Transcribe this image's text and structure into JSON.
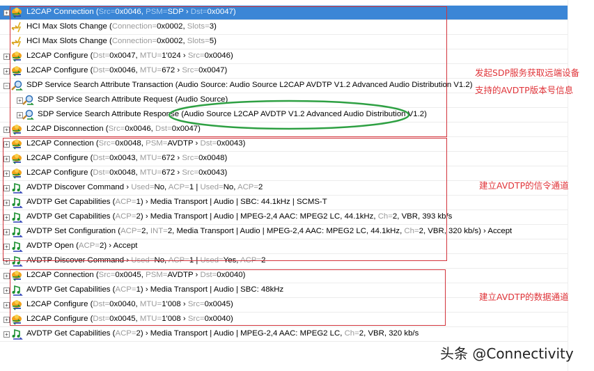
{
  "rows": [
    {
      "icon": "l2cap",
      "level": 0,
      "exp": "+",
      "sel": true,
      "seg": [
        [
          "L2CAP Connection (",
          0
        ],
        [
          "Src=",
          1
        ],
        [
          "0x0046, ",
          0
        ],
        [
          "PSM=",
          1
        ],
        [
          "SDP › ",
          0
        ],
        [
          "Dst=",
          1
        ],
        [
          "0x0047)",
          0
        ]
      ]
    },
    {
      "icon": "hci",
      "level": 0,
      "exp": "",
      "seg": [
        [
          "HCI Max Slots Change (",
          0
        ],
        [
          "Connection=",
          1
        ],
        [
          "0x0002, ",
          0
        ],
        [
          "Slots=",
          1
        ],
        [
          "3)",
          0
        ]
      ]
    },
    {
      "icon": "hci",
      "level": 0,
      "exp": "",
      "seg": [
        [
          "HCI Max Slots Change (",
          0
        ],
        [
          "Connection=",
          1
        ],
        [
          "0x0002, ",
          0
        ],
        [
          "Slots=",
          1
        ],
        [
          "5)",
          0
        ]
      ]
    },
    {
      "icon": "l2cap",
      "level": 0,
      "exp": "+",
      "seg": [
        [
          "L2CAP Configure (",
          0
        ],
        [
          "Dst=",
          1
        ],
        [
          "0x0047, ",
          0
        ],
        [
          "MTU=",
          1
        ],
        [
          "1'024 › ",
          0
        ],
        [
          "Src=",
          1
        ],
        [
          "0x0046)",
          0
        ]
      ]
    },
    {
      "icon": "l2cap",
      "level": 0,
      "exp": "+",
      "seg": [
        [
          "L2CAP Configure (",
          0
        ],
        [
          "Dst=",
          1
        ],
        [
          "0x0046, ",
          0
        ],
        [
          "MTU=",
          1
        ],
        [
          "672 › ",
          0
        ],
        [
          "Src=",
          1
        ],
        [
          "0x0047)",
          0
        ]
      ]
    },
    {
      "icon": "sdp",
      "level": 0,
      "exp": "−",
      "seg": [
        [
          "SDP Service Search Attribute Transaction (Audio Source: Audio Source L2CAP AVDTP V1.2 Advanced Audio Distribution V1.2)",
          0
        ]
      ]
    },
    {
      "icon": "sdp",
      "level": 1,
      "exp": "+",
      "seg": [
        [
          "SDP Service Search Attribute Request (Audio Source)",
          0
        ]
      ]
    },
    {
      "icon": "sdp",
      "level": 1,
      "exp": "+",
      "seg": [
        [
          "SDP Service Search Attribute Response (Audio Source L2CAP AVDTP V1.2 Advanced Audio Distribution V1.2)",
          0
        ]
      ]
    },
    {
      "icon": "l2cap",
      "level": 0,
      "exp": "+",
      "seg": [
        [
          "L2CAP Disconnection (",
          0
        ],
        [
          "Src=",
          1
        ],
        [
          "0x0046, ",
          0
        ],
        [
          "Dst=",
          1
        ],
        [
          "0x0047)",
          0
        ]
      ]
    },
    {
      "icon": "l2cap",
      "level": 0,
      "exp": "+",
      "seg": [
        [
          "L2CAP Connection (",
          0
        ],
        [
          "Src=",
          1
        ],
        [
          "0x0048, ",
          0
        ],
        [
          "PSM=",
          1
        ],
        [
          "AVDTP › ",
          0
        ],
        [
          "Dst=",
          1
        ],
        [
          "0x0043)",
          0
        ]
      ]
    },
    {
      "icon": "l2cap",
      "level": 0,
      "exp": "+",
      "seg": [
        [
          "L2CAP Configure (",
          0
        ],
        [
          "Dst=",
          1
        ],
        [
          "0x0043, ",
          0
        ],
        [
          "MTU=",
          1
        ],
        [
          "672 › ",
          0
        ],
        [
          "Src=",
          1
        ],
        [
          "0x0048)",
          0
        ]
      ]
    },
    {
      "icon": "l2cap",
      "level": 0,
      "exp": "+",
      "seg": [
        [
          "L2CAP Configure (",
          0
        ],
        [
          "Dst=",
          1
        ],
        [
          "0x0048, ",
          0
        ],
        [
          "MTU=",
          1
        ],
        [
          "672 › ",
          0
        ],
        [
          "Src=",
          1
        ],
        [
          "0x0043)",
          0
        ]
      ]
    },
    {
      "icon": "avdtp",
      "level": 0,
      "exp": "+",
      "seg": [
        [
          "AVDTP Discover Command › ",
          0
        ],
        [
          "Used=",
          1
        ],
        [
          "No, ",
          0
        ],
        [
          "ACP=",
          1
        ],
        [
          "1 | ",
          0
        ],
        [
          "Used=",
          1
        ],
        [
          "No, ",
          0
        ],
        [
          "ACP=",
          1
        ],
        [
          "2",
          0
        ]
      ]
    },
    {
      "icon": "avdtp",
      "level": 0,
      "exp": "+",
      "seg": [
        [
          "AVDTP Get Capabilities (",
          0
        ],
        [
          "ACP=",
          1
        ],
        [
          "1) › Media Transport | Audio | SBC: 44.1kHz | SCMS-T",
          0
        ]
      ]
    },
    {
      "icon": "avdtp",
      "level": 0,
      "exp": "+",
      "seg": [
        [
          "AVDTP Get Capabilities (",
          0
        ],
        [
          "ACP=",
          1
        ],
        [
          "2) › Media Transport | Audio | MPEG-2,4 AAC: MPEG2 LC, 44.1kHz, ",
          0
        ],
        [
          "Ch=",
          1
        ],
        [
          "2, VBR, 393 kb/s",
          0
        ]
      ]
    },
    {
      "icon": "avdtp",
      "level": 0,
      "exp": "+",
      "seg": [
        [
          "AVDTP Set Configuration (",
          0
        ],
        [
          "ACP=",
          1
        ],
        [
          "2, ",
          0
        ],
        [
          "INT=",
          1
        ],
        [
          "2, Media Transport | Audio | MPEG-2,4 AAC: MPEG2 LC, 44.1kHz, ",
          0
        ],
        [
          "Ch=",
          1
        ],
        [
          "2, VBR, 320 kb/s) › Accept",
          0
        ]
      ]
    },
    {
      "icon": "avdtp",
      "level": 0,
      "exp": "+",
      "seg": [
        [
          "AVDTP Open (",
          0
        ],
        [
          "ACP=",
          1
        ],
        [
          "2) › Accept",
          0
        ]
      ]
    },
    {
      "icon": "avdtp",
      "level": 0,
      "exp": "+",
      "seg": [
        [
          "AVDTP Discover Command › ",
          0
        ],
        [
          "Used=",
          1
        ],
        [
          "No, ",
          0
        ],
        [
          "ACP=",
          1
        ],
        [
          "1 | ",
          0
        ],
        [
          "Used=",
          1
        ],
        [
          "Yes, ",
          0
        ],
        [
          "ACP=",
          1
        ],
        [
          "2",
          0
        ]
      ]
    },
    {
      "icon": "l2cap",
      "level": 0,
      "exp": "+",
      "seg": [
        [
          "L2CAP Connection (",
          0
        ],
        [
          "Src=",
          1
        ],
        [
          "0x0045, ",
          0
        ],
        [
          "PSM=",
          1
        ],
        [
          "AVDTP › ",
          0
        ],
        [
          "Dst=",
          1
        ],
        [
          "0x0040)",
          0
        ]
      ]
    },
    {
      "icon": "avdtp",
      "level": 0,
      "exp": "+",
      "seg": [
        [
          "AVDTP Get Capabilities (",
          0
        ],
        [
          "ACP=",
          1
        ],
        [
          "1) › Media Transport | Audio | SBC: 48kHz",
          0
        ]
      ]
    },
    {
      "icon": "l2cap",
      "level": 0,
      "exp": "+",
      "seg": [
        [
          "L2CAP Configure (",
          0
        ],
        [
          "Dst=",
          1
        ],
        [
          "0x0040, ",
          0
        ],
        [
          "MTU=",
          1
        ],
        [
          "1'008 › ",
          0
        ],
        [
          "Src=",
          1
        ],
        [
          "0x0045)",
          0
        ]
      ]
    },
    {
      "icon": "l2cap",
      "level": 0,
      "exp": "+",
      "seg": [
        [
          "L2CAP Configure (",
          0
        ],
        [
          "Dst=",
          1
        ],
        [
          "0x0045, ",
          0
        ],
        [
          "MTU=",
          1
        ],
        [
          "1'008 › ",
          0
        ],
        [
          "Src=",
          1
        ],
        [
          "0x0040)",
          0
        ]
      ]
    },
    {
      "icon": "avdtp",
      "level": 0,
      "exp": "+",
      "seg": [
        [
          "AVDTP Get Capabilities (",
          0
        ],
        [
          "ACP=",
          1
        ],
        [
          "2) › Media Transport | Audio | MPEG-2,4 AAC: MPEG2 LC, ",
          0
        ],
        [
          "Ch=",
          1
        ],
        [
          "2, VBR, 320 kb/s",
          0
        ]
      ]
    }
  ],
  "annotations": {
    "sdp_line1": "发起SDP服务获取远端设备",
    "sdp_line2": "支持的AVDTP版本号信息",
    "signaling": "建立AVDTP的信令通道",
    "data": "建立AVDTP的数据通道"
  },
  "watermark": "头条 @Connectivity",
  "colors": {
    "selection": "#3b86d6",
    "annotation": "#e0353a",
    "ellipse": "#2ea043"
  }
}
